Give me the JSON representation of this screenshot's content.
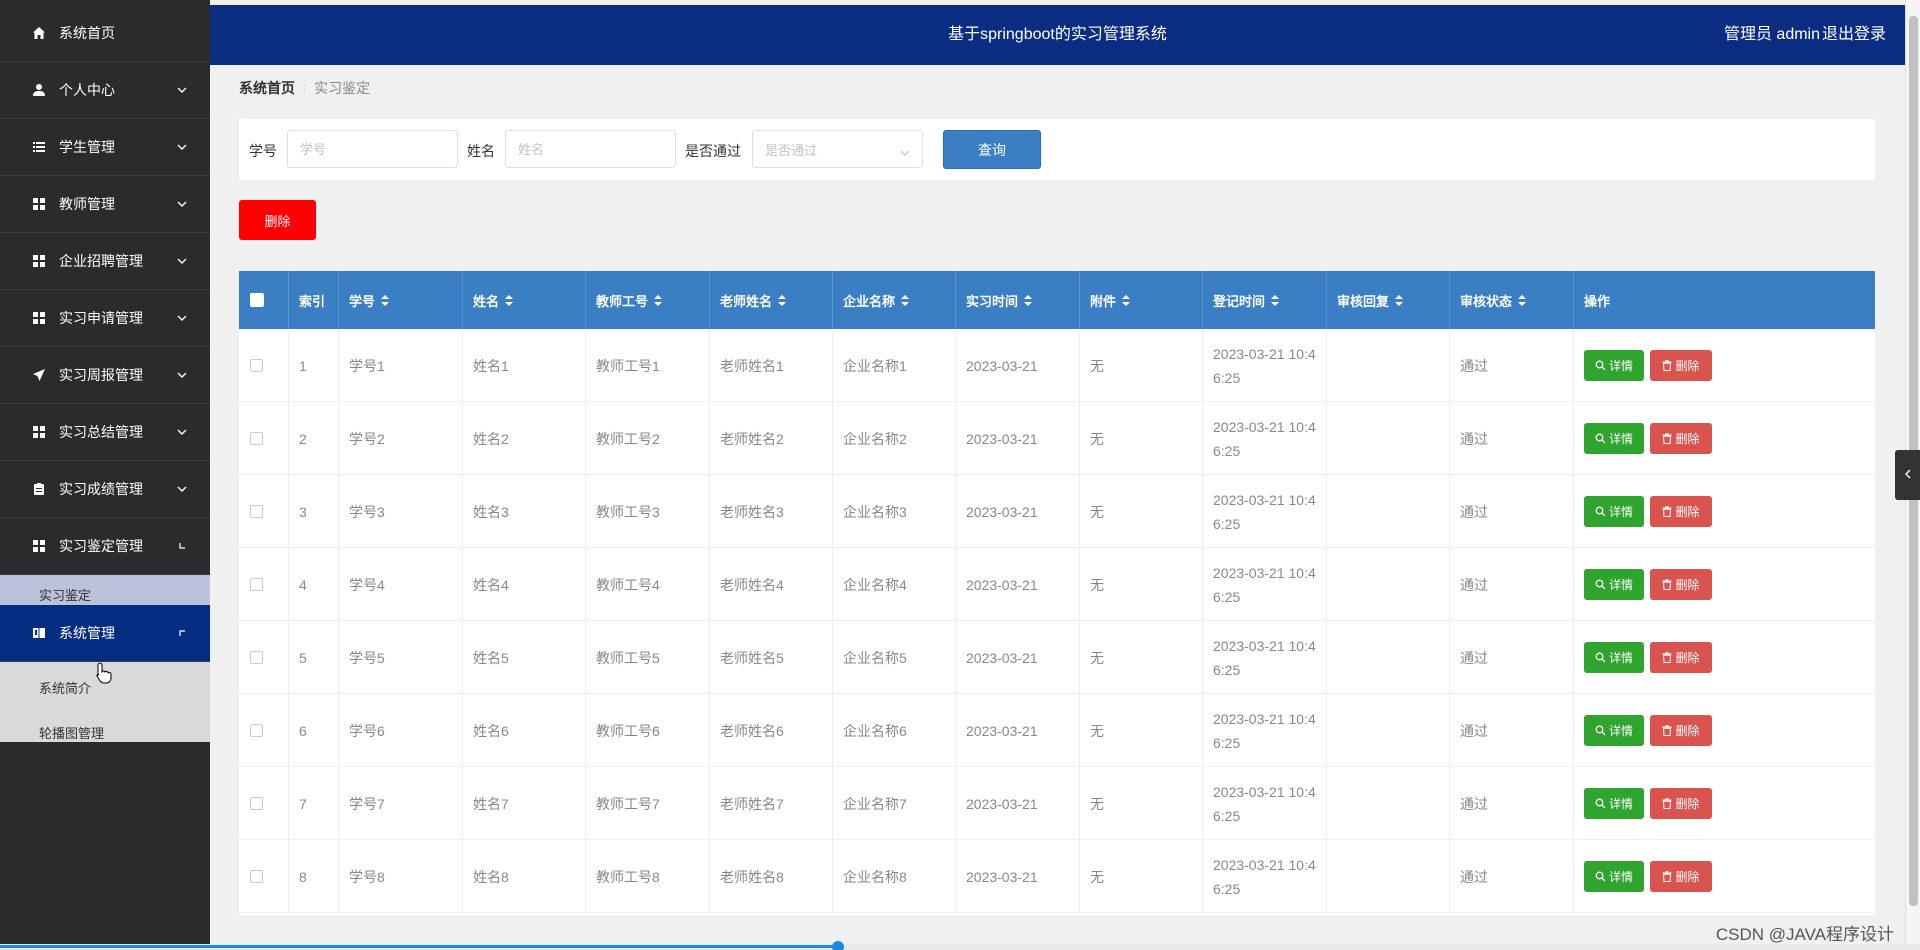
{
  "app": {
    "title": "基于springboot的实习管理系统",
    "user": "管理员 admin",
    "logout": "退出登录"
  },
  "sidebar": {
    "items": [
      {
        "label": "系统首页",
        "icon": "home-icon"
      },
      {
        "label": "个人中心",
        "icon": "user-icon"
      },
      {
        "label": "学生管理",
        "icon": "list-icon"
      },
      {
        "label": "教师管理",
        "icon": "grid-icon"
      },
      {
        "label": "企业招聘管理",
        "icon": "grid-icon"
      },
      {
        "label": "实习申请管理",
        "icon": "grid-icon"
      },
      {
        "label": "实习周报管理",
        "icon": "send-icon"
      },
      {
        "label": "实习总结管理",
        "icon": "grid-icon"
      },
      {
        "label": "实习成绩管理",
        "icon": "clipboard-icon"
      },
      {
        "label": "实习鉴定管理",
        "icon": "grid-icon"
      },
      {
        "label": "系统管理",
        "icon": "book-icon"
      }
    ],
    "subitems": {
      "appraisal": "实习鉴定",
      "intro": "系统简介",
      "carousel": "轮播图管理"
    }
  },
  "breadcrumb": {
    "home": "系统首页",
    "current": "实习鉴定"
  },
  "search": {
    "student_no_label": "学号",
    "student_no_placeholder": "学号",
    "name_label": "姓名",
    "name_placeholder": "姓名",
    "passed_label": "是否通过",
    "passed_placeholder": "是否通过",
    "query_button": "查询"
  },
  "toolbar": {
    "delete_label": "删除"
  },
  "table": {
    "columns": [
      "索引",
      "学号",
      "姓名",
      "教师工号",
      "老师姓名",
      "企业名称",
      "实习时间",
      "附件",
      "登记时间",
      "审核回复",
      "审核状态",
      "操作"
    ],
    "rows": [
      {
        "index": "1",
        "student_no": "学号1",
        "name": "姓名1",
        "teacher_no": "教师工号1",
        "teacher_name": "老师姓名1",
        "company": "企业名称1",
        "date": "2023-03-21",
        "attachment": "无",
        "reg_time": "2023-03-21 10:46:25",
        "reply": "",
        "status": "通过"
      },
      {
        "index": "2",
        "student_no": "学号2",
        "name": "姓名2",
        "teacher_no": "教师工号2",
        "teacher_name": "老师姓名2",
        "company": "企业名称2",
        "date": "2023-03-21",
        "attachment": "无",
        "reg_time": "2023-03-21 10:46:25",
        "reply": "",
        "status": "通过"
      },
      {
        "index": "3",
        "student_no": "学号3",
        "name": "姓名3",
        "teacher_no": "教师工号3",
        "teacher_name": "老师姓名3",
        "company": "企业名称3",
        "date": "2023-03-21",
        "attachment": "无",
        "reg_time": "2023-03-21 10:46:25",
        "reply": "",
        "status": "通过"
      },
      {
        "index": "4",
        "student_no": "学号4",
        "name": "姓名4",
        "teacher_no": "教师工号4",
        "teacher_name": "老师姓名4",
        "company": "企业名称4",
        "date": "2023-03-21",
        "attachment": "无",
        "reg_time": "2023-03-21 10:46:25",
        "reply": "",
        "status": "通过"
      },
      {
        "index": "5",
        "student_no": "学号5",
        "name": "姓名5",
        "teacher_no": "教师工号5",
        "teacher_name": "老师姓名5",
        "company": "企业名称5",
        "date": "2023-03-21",
        "attachment": "无",
        "reg_time": "2023-03-21 10:46:25",
        "reply": "",
        "status": "通过"
      },
      {
        "index": "6",
        "student_no": "学号6",
        "name": "姓名6",
        "teacher_no": "教师工号6",
        "teacher_name": "老师姓名6",
        "company": "企业名称6",
        "date": "2023-03-21",
        "attachment": "无",
        "reg_time": "2023-03-21 10:46:25",
        "reply": "",
        "status": "通过"
      },
      {
        "index": "7",
        "student_no": "学号7",
        "name": "姓名7",
        "teacher_no": "教师工号7",
        "teacher_name": "老师姓名7",
        "company": "企业名称7",
        "date": "2023-03-21",
        "attachment": "无",
        "reg_time": "2023-03-21 10:46:25",
        "reply": "",
        "status": "通过"
      },
      {
        "index": "8",
        "student_no": "学号8",
        "name": "姓名8",
        "teacher_no": "教师工号8",
        "teacher_name": "老师姓名8",
        "company": "企业名称8",
        "date": "2023-03-21",
        "attachment": "无",
        "reg_time": "2023-03-21 10:46:25",
        "reply": "",
        "status": "通过"
      }
    ],
    "detail_label": "详情",
    "delete_label": "删除"
  },
  "watermark": "CSDN @JAVA程序设计",
  "colors": {
    "topbar": "#0a2d82",
    "sidebar": "#2b2b2b",
    "active_menu": "#022d80",
    "table_header": "#3a7ec4",
    "detail_button": "#2fa42f",
    "delete_button": "#d9534f",
    "bulk_delete": "#ff0000"
  }
}
